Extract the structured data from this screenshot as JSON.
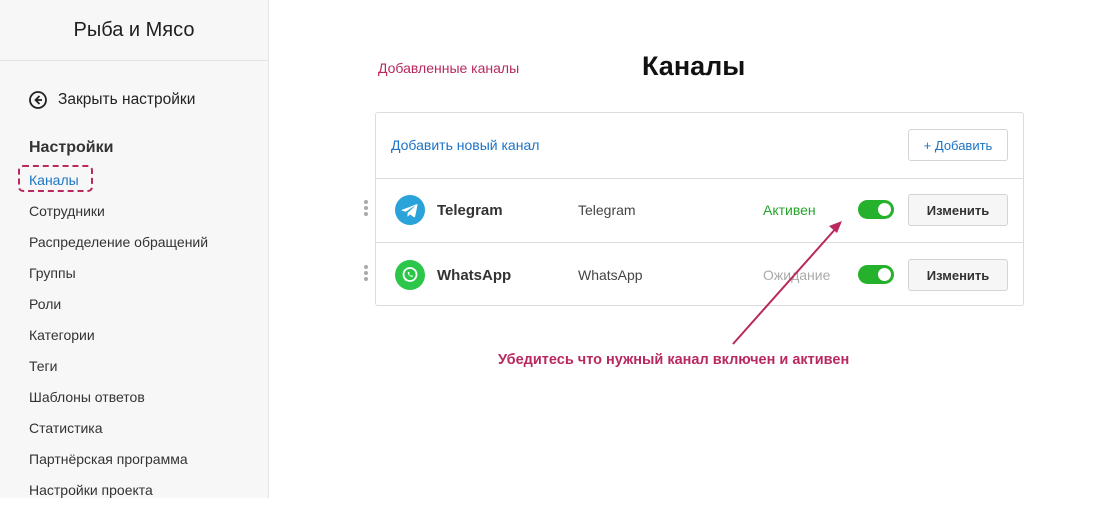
{
  "brand": {
    "name": "Рыба и Мясо"
  },
  "sidebar": {
    "close_label": "Закрыть настройки",
    "section_title": "Настройки",
    "items": [
      {
        "label": "Каналы",
        "active": true
      },
      {
        "label": "Сотрудники"
      },
      {
        "label": "Распределение обращений"
      },
      {
        "label": "Группы"
      },
      {
        "label": "Роли"
      },
      {
        "label": "Категории"
      },
      {
        "label": "Теги"
      },
      {
        "label": "Шаблоны ответов"
      },
      {
        "label": "Статистика"
      },
      {
        "label": "Партнёрская программа"
      },
      {
        "label": "Настройки проекта"
      }
    ]
  },
  "main": {
    "added_channels_label": "Добавленные каналы",
    "title": "Каналы",
    "card": {
      "add_new_label": "Добавить новый канал",
      "add_button_label": "+ Добавить"
    },
    "channels": [
      {
        "name": "Telegram",
        "type": "Telegram",
        "status": "Активен",
        "status_color": "#25a42b",
        "enabled": true,
        "icon": "telegram-icon",
        "icon_color": "#2aa3db",
        "edit_label": "Изменить"
      },
      {
        "name": "WhatsApp",
        "type": "WhatsApp",
        "status": "Ожидание",
        "status_color": "#aaaaaa",
        "enabled": true,
        "icon": "whatsapp-icon",
        "icon_color": "#2bc64a",
        "edit_label": "Изменить"
      }
    ],
    "annotation": "Убедитесь что нужный канал включен и активен"
  },
  "colors": {
    "accent": "#1b74c5",
    "highlight": "#b9285e",
    "toggle_on": "#25b12b"
  }
}
